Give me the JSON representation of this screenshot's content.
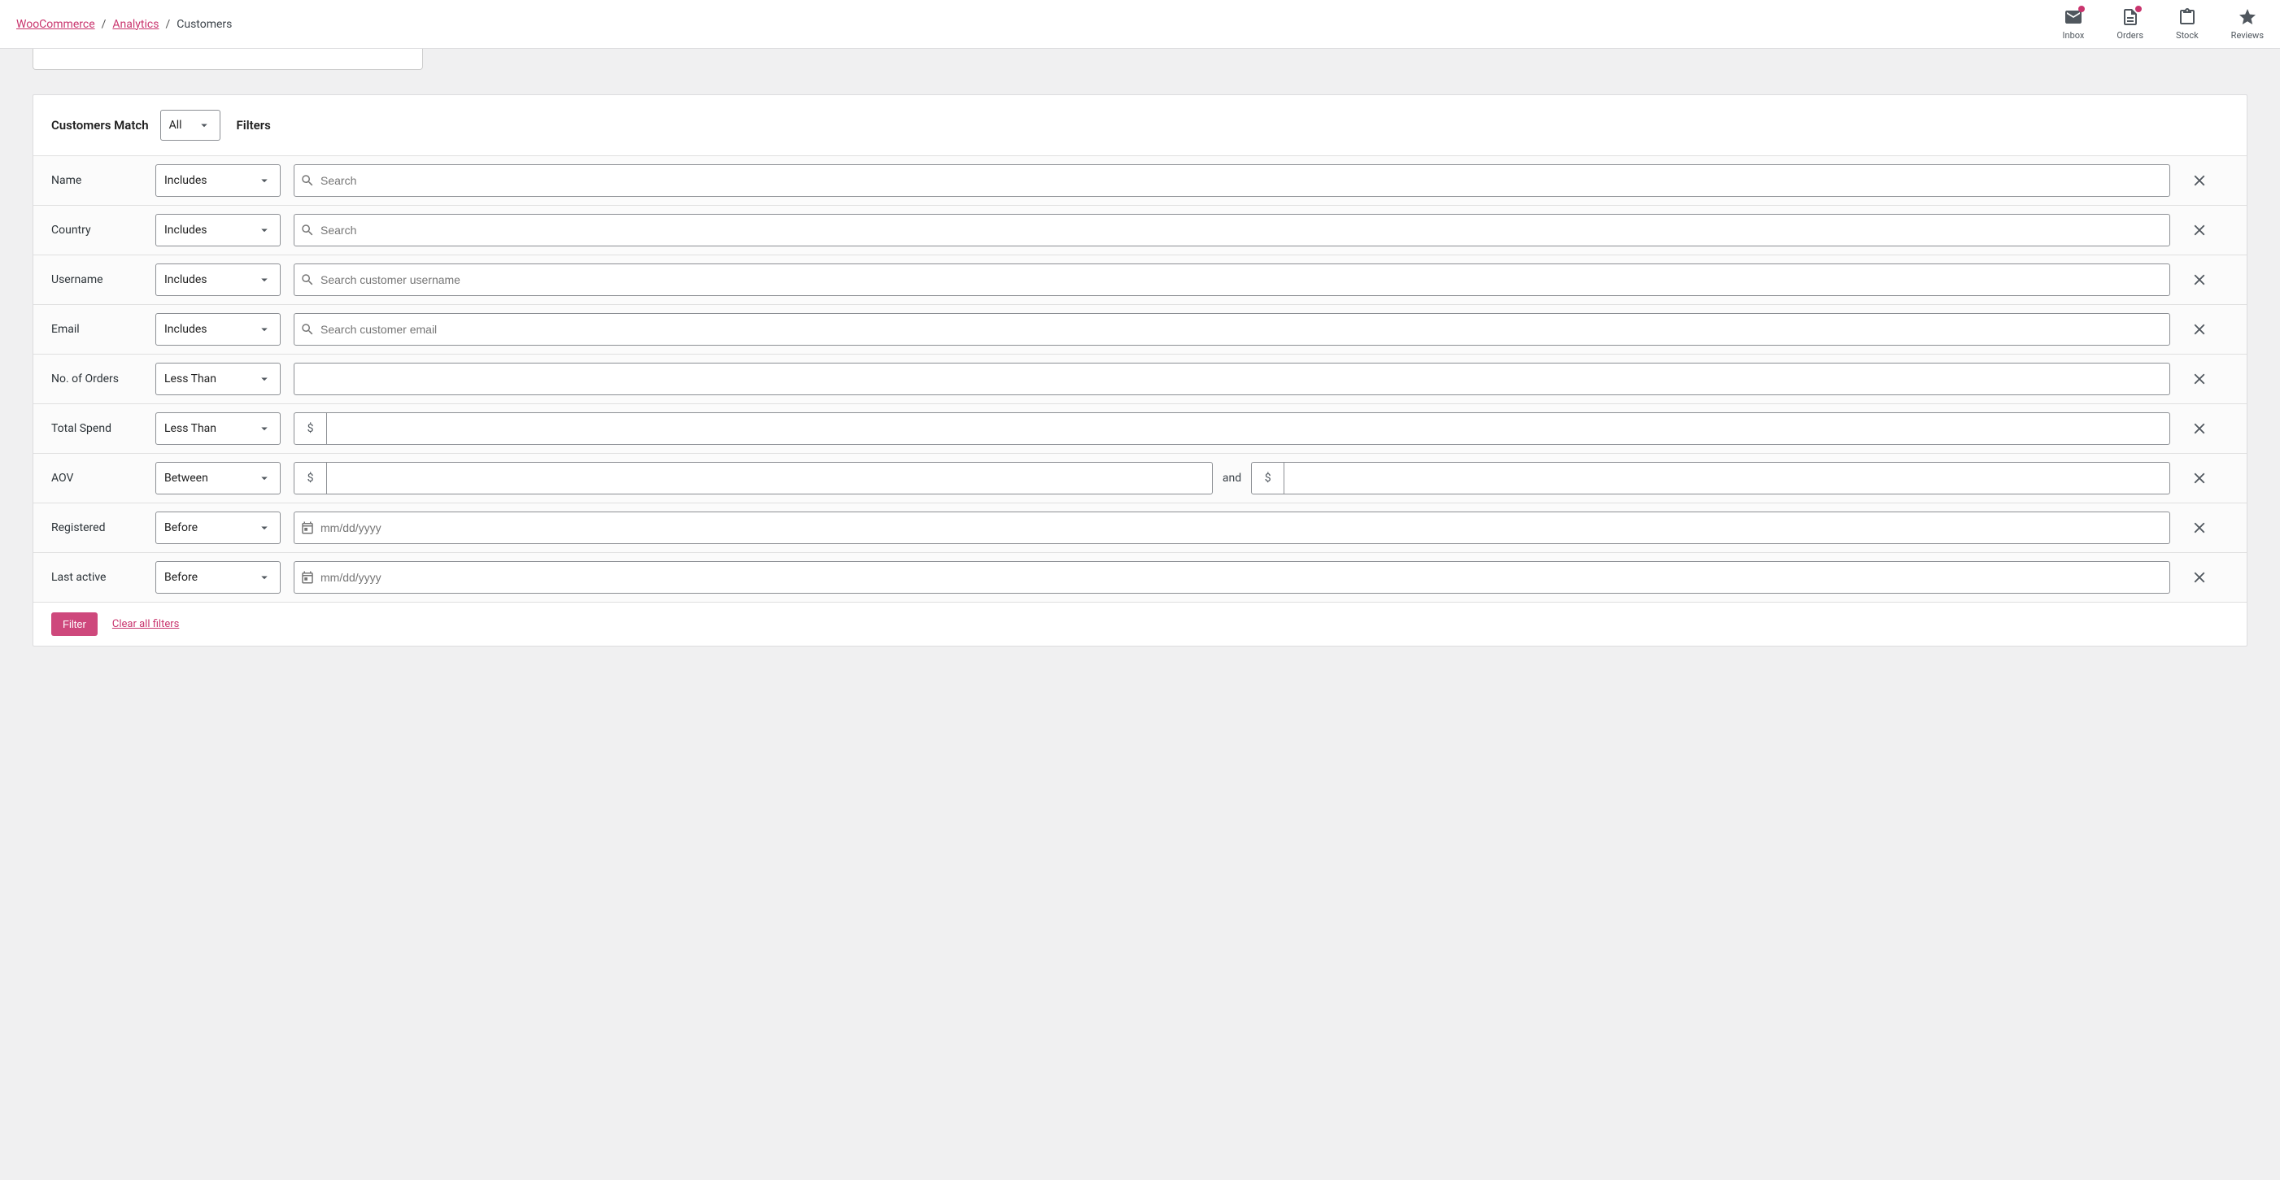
{
  "breadcrumb": {
    "woo": "WooCommerce",
    "analytics": "Analytics",
    "current": "Customers"
  },
  "topnav": {
    "inbox": "Inbox",
    "orders": "Orders",
    "stock": "Stock",
    "reviews": "Reviews"
  },
  "header": {
    "match_label": "Customers Match",
    "match_selected": "All",
    "filters_label": "Filters"
  },
  "rows": {
    "name": {
      "label": "Name",
      "op": "Includes",
      "placeholder": "Search"
    },
    "country": {
      "label": "Country",
      "op": "Includes",
      "placeholder": "Search"
    },
    "username": {
      "label": "Username",
      "op": "Includes",
      "placeholder": "Search customer username"
    },
    "email": {
      "label": "Email",
      "op": "Includes",
      "placeholder": "Search customer email"
    },
    "orders": {
      "label": "No. of Orders",
      "op": "Less Than"
    },
    "spend": {
      "label": "Total Spend",
      "op": "Less Than",
      "currency": "$"
    },
    "aov": {
      "label": "AOV",
      "op": "Between",
      "currency": "$",
      "and": "and"
    },
    "registered": {
      "label": "Registered",
      "op": "Before",
      "placeholder": "mm/dd/yyyy"
    },
    "last_active": {
      "label": "Last active",
      "op": "Before",
      "placeholder": "mm/dd/yyyy"
    }
  },
  "footer": {
    "filter_btn": "Filter",
    "clear_link": "Clear all filters"
  }
}
